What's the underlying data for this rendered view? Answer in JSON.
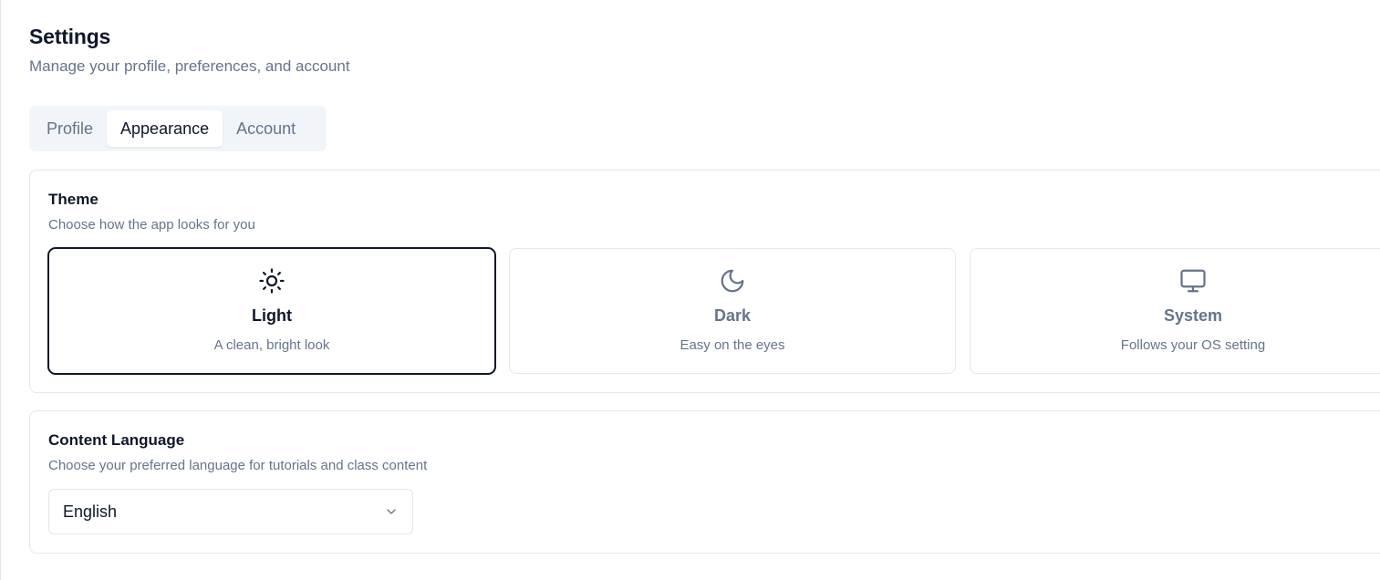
{
  "header": {
    "title": "Settings",
    "subtitle": "Manage your profile, preferences, and account"
  },
  "tabs": [
    {
      "label": "Profile",
      "active": false
    },
    {
      "label": "Appearance",
      "active": true
    },
    {
      "label": "Account",
      "active": false
    }
  ],
  "theme": {
    "title": "Theme",
    "description": "Choose how the app looks for you",
    "options": [
      {
        "icon": "sun-icon",
        "name": "Light",
        "description": "A clean, bright look",
        "selected": true
      },
      {
        "icon": "moon-icon",
        "name": "Dark",
        "description": "Easy on the eyes",
        "selected": false
      },
      {
        "icon": "monitor-icon",
        "name": "System",
        "description": "Follows your OS setting",
        "selected": false
      }
    ]
  },
  "language": {
    "title": "Content Language",
    "description": "Choose your preferred language for tutorials and class content",
    "selected": "English",
    "icon": "chevron-down-icon"
  },
  "colors": {
    "text_primary": "#0f172a",
    "text_muted": "#64748b",
    "border": "#e2e8f0",
    "tab_background": "#f1f5f9"
  }
}
